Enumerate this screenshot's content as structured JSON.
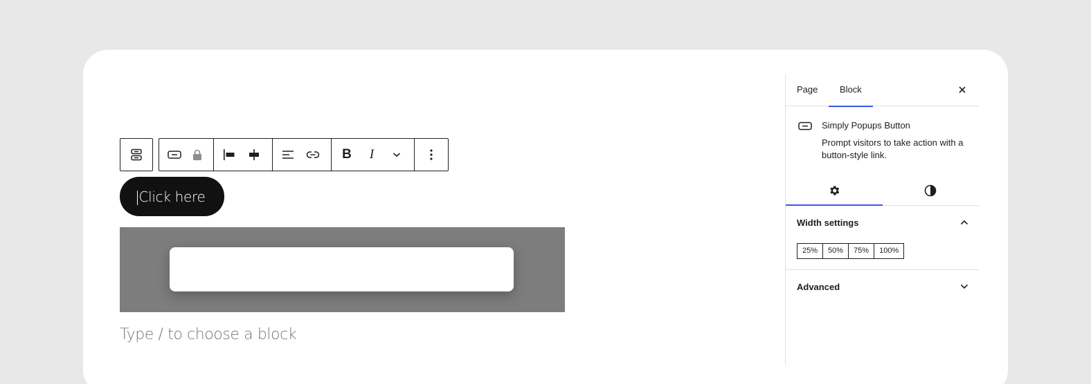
{
  "toolbar": {
    "items": [
      {
        "name": "popup-block-icon"
      },
      {
        "name": "button-icon"
      },
      {
        "name": "lock-icon"
      },
      {
        "name": "justify-left-icon"
      },
      {
        "name": "justify-center-icon"
      },
      {
        "name": "align-left-icon"
      },
      {
        "name": "link-icon"
      },
      {
        "name": "bold-icon",
        "label": "B"
      },
      {
        "name": "italic-icon",
        "label": "I"
      },
      {
        "name": "chevron-down-icon"
      },
      {
        "name": "more-vertical-icon"
      }
    ]
  },
  "canvas": {
    "button_text": "Click here",
    "placeholder": "Type / to choose a block"
  },
  "sidebar": {
    "tabs": [
      "Page",
      "Block"
    ],
    "active_tab": "Block",
    "block": {
      "title": "Simply Popups Button",
      "description": "Prompt visitors to take action with a button-style link."
    },
    "style_tabs": [
      {
        "icon": "gear-icon",
        "active": true
      },
      {
        "icon": "contrast-icon",
        "active": false
      }
    ],
    "width_panel": {
      "title": "Width settings",
      "options": [
        "25%",
        "50%",
        "75%",
        "100%"
      ]
    },
    "advanced_panel": {
      "title": "Advanced"
    }
  },
  "colors": {
    "accent": "#3858e9",
    "button_bg": "#111111",
    "overlay": "#7d7d7d"
  }
}
